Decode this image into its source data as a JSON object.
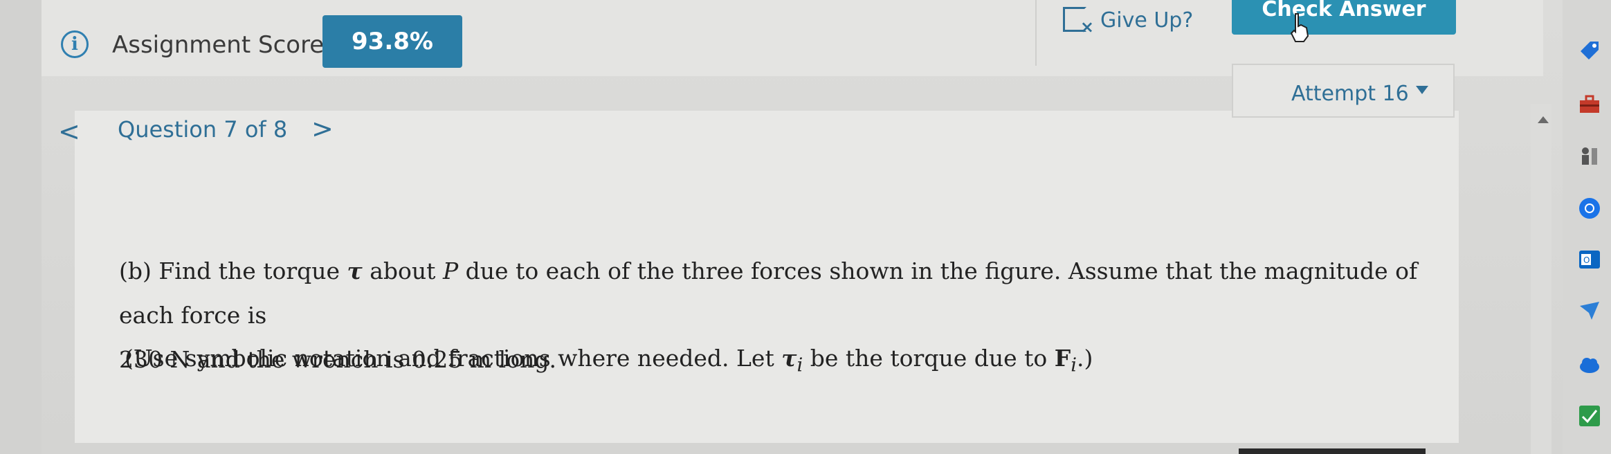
{
  "header": {
    "score_label": "Assignment Score:",
    "score_value": "93.8%",
    "give_up_label": "Give Up?",
    "check_answer_label": "Check Answer"
  },
  "question_nav": {
    "prev_glyph": "<",
    "label": "Question 7 of 8",
    "next_glyph": ">",
    "attempt_label": "Attempt 16"
  },
  "question": {
    "part": "(b) Find the torque",
    "tau": "τ",
    "about": "about",
    "P": "P",
    "rest_line1": "due to each of the three forces shown in the figure. Assume that the magnitude of each force is",
    "line2": "230 N and the wrench is 0.25 m long.",
    "note_prefix": "(Use symbolic notation and fractions where needed. Let",
    "note_tau_i": "τ",
    "note_sub_i": "i",
    "note_mid": "be the torque due to",
    "note_F": "F",
    "note_sub_i2": "i",
    "note_suffix": ".)"
  },
  "colors": {
    "accent": "#2b7ea7",
    "link": "#2f6f96",
    "text": "#222222"
  },
  "dock_icons": [
    "tag-icon",
    "toolbox-icon",
    "chess-icon",
    "chrome-icon",
    "outlook-icon",
    "send-icon",
    "cloud-icon",
    "chart-check-icon"
  ]
}
